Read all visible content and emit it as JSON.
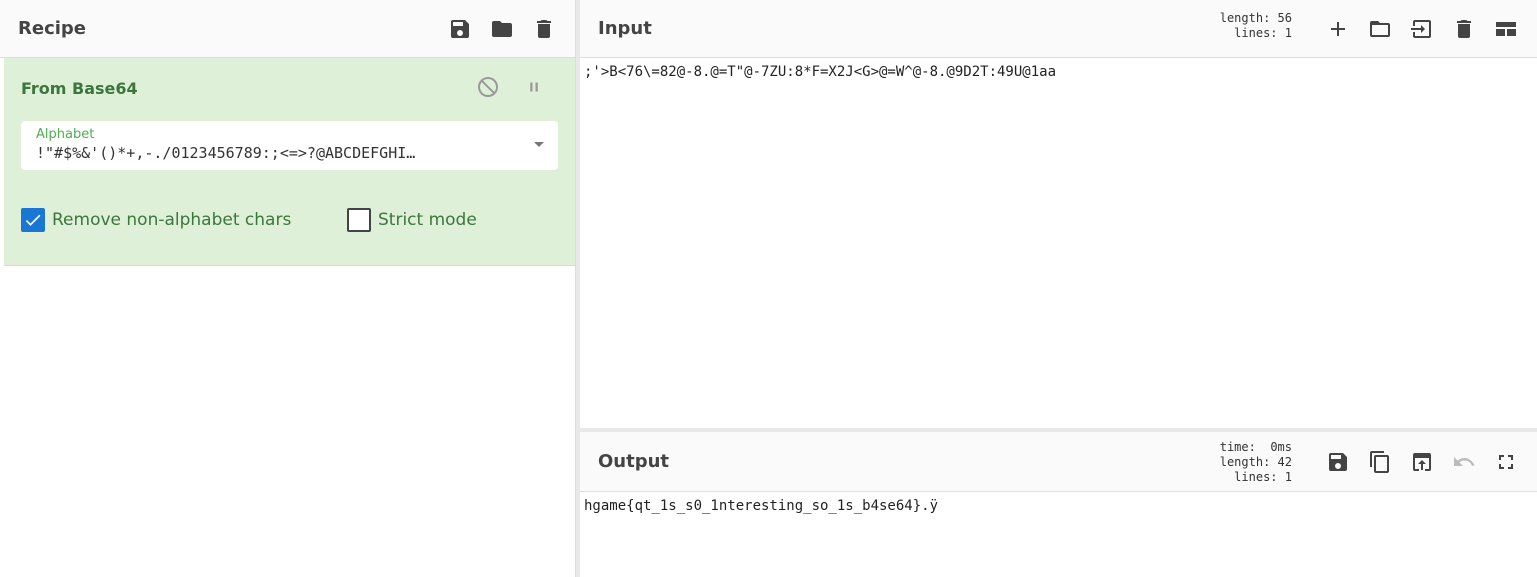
{
  "recipe": {
    "title": "Recipe",
    "icons": [
      "save-icon",
      "folder-icon",
      "trash-icon"
    ]
  },
  "operation": {
    "name": "From Base64",
    "alphabet_label": "Alphabet",
    "alphabet_value": "!\"#$%&'()*+,-./0123456789:;<=>?@ABCDEFGHI…",
    "remove_label": "Remove non-alphabet chars",
    "remove_checked": true,
    "strict_label": "Strict mode",
    "strict_checked": false
  },
  "input": {
    "title": "Input",
    "length_label": "length:",
    "length": "56",
    "lines_label": "lines:",
    "lines": "1",
    "text": ";'>B<76\\=82@-8.@=T\"@-7ZU:8*F=X2J<G>@=W^@-8.@9D2T:49U@1aa"
  },
  "output": {
    "title": "Output",
    "time_label": "time:",
    "time": "0ms",
    "length_label": "length:",
    "length": "42",
    "lines_label": "lines:",
    "lines": "1",
    "text": "hgame{qt_1s_s0_1nteresting_so_1s_b4se64}.ÿ"
  },
  "colors": {
    "accent": "#1976d2",
    "op_bg": "#dff0d8",
    "op_text": "#3c763d"
  }
}
